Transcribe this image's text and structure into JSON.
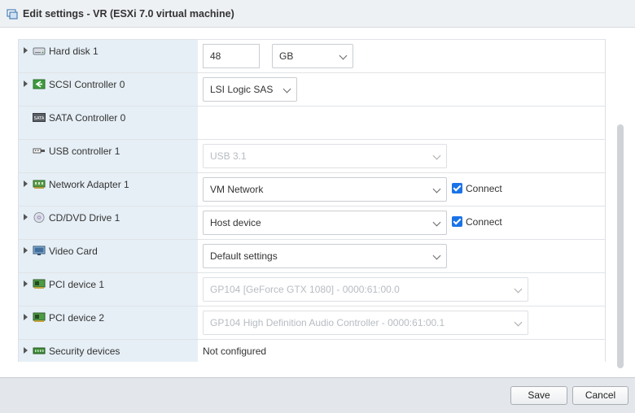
{
  "window": {
    "title": "Edit settings - VR (ESXi 7.0 virtual machine)"
  },
  "devices": [
    {
      "label": "Hard disk 1",
      "icon": "hard-disk-icon",
      "expandable": true,
      "size_value": "48",
      "size_unit": "GB",
      "removable": true
    },
    {
      "label": "SCSI Controller 0",
      "icon": "scsi-controller-icon",
      "expandable": true,
      "select": "LSI Logic SAS",
      "removable": true
    },
    {
      "label": "SATA Controller 0",
      "icon": "sata-controller-icon",
      "expandable": false,
      "removable": true
    },
    {
      "label": "USB controller 1",
      "icon": "usb-icon",
      "expandable": false,
      "select": "USB 3.1",
      "disabled": true,
      "removable": true
    },
    {
      "label": "Network Adapter 1",
      "icon": "network-adapter-icon",
      "expandable": true,
      "select": "VM Network",
      "connect_label": "Connect",
      "connected": true,
      "removable": true
    },
    {
      "label": "CD/DVD Drive 1",
      "icon": "cd-dvd-icon",
      "expandable": true,
      "select": "Host device",
      "connect_label": "Connect",
      "connected": true,
      "removable": true
    },
    {
      "label": "Video Card",
      "icon": "video-card-icon",
      "expandable": true,
      "select": "Default settings",
      "removable": false
    },
    {
      "label": "PCI device 1",
      "icon": "pci-device-icon",
      "expandable": true,
      "select": "GP104 [GeForce GTX 1080] - 0000:61:00.0",
      "disabled": true,
      "removable": true
    },
    {
      "label": "PCI device 2",
      "icon": "pci-device-icon",
      "expandable": true,
      "select": "GP104 High Definition Audio Controller - 0000:61:00.1",
      "disabled": true,
      "removable": true
    },
    {
      "label": "Security devices",
      "icon": "security-devices-icon",
      "expandable": true,
      "value": "Not configured",
      "removable": false
    }
  ],
  "footer": {
    "save_label": "Save",
    "cancel_label": "Cancel"
  },
  "colors": {
    "name_column_bg": "#e6eff6",
    "checkbox_accent": "#1a73e8",
    "footer_bg": "#e3e6ea"
  }
}
